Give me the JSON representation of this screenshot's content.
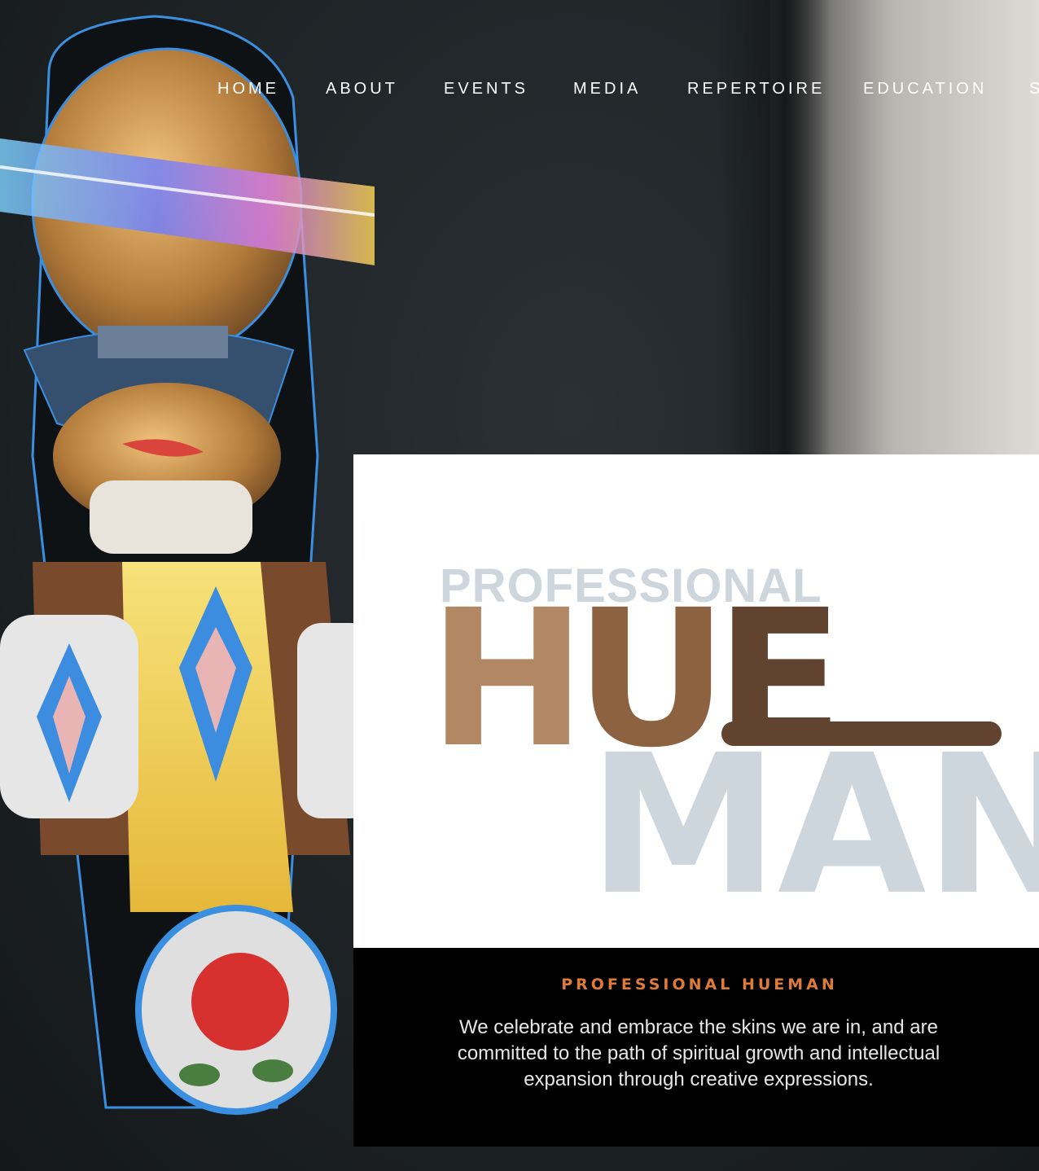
{
  "nav": {
    "items": [
      {
        "label": "HOME"
      },
      {
        "label": "ABOUT"
      },
      {
        "label": "EVENTS"
      },
      {
        "label": "MEDIA"
      },
      {
        "label": "REPERTOIRE"
      },
      {
        "label": "EDUCATION"
      },
      {
        "label": "S"
      }
    ]
  },
  "hero": {
    "logo": {
      "line1": "PROFESSIONAL",
      "h": "H",
      "u": "U",
      "e": "E",
      "line3": "MAN"
    },
    "heading": "PROFESSIONAL HUEMAN",
    "text": "We celebrate and embrace the skins we are in, and are committed to the path of spiritual growth and intellectual expansion through creative expressions."
  },
  "colors": {
    "accent_orange": "#e07a38",
    "logo_light": "#cdd6dc",
    "logo_tan": "#b28763",
    "logo_brown": "#8c6240",
    "logo_dark_brown": "#62432f"
  }
}
